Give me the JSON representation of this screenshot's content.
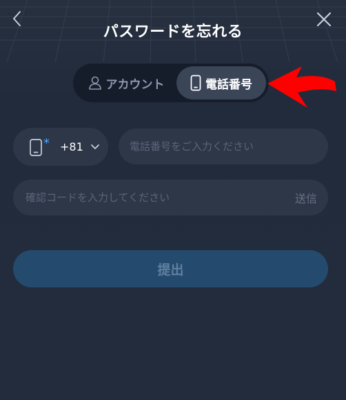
{
  "header": {
    "title": "パスワードを忘れる",
    "back_icon": "chevron-left-icon",
    "close_icon": "close-icon"
  },
  "tabs": [
    {
      "label": "アカウント",
      "icon": "user-icon",
      "selected": false
    },
    {
      "label": "電話番号",
      "icon": "smartphone-icon",
      "selected": true
    }
  ],
  "phone": {
    "country_code": "+81",
    "required_mark": "*",
    "placeholder": "電話番号をご入力ください",
    "value": ""
  },
  "verification": {
    "placeholder": "確認コードを入力してください",
    "value": "",
    "send_label": "送信"
  },
  "submit_label": "提出",
  "colors": {
    "background": "#222b3c",
    "field": "#2d3748",
    "tab_track": "#161d2a",
    "tab_selected": "#3a4558",
    "submit": "#244a6e",
    "accent": "#4da3ff",
    "annotation": "#ff0000"
  }
}
